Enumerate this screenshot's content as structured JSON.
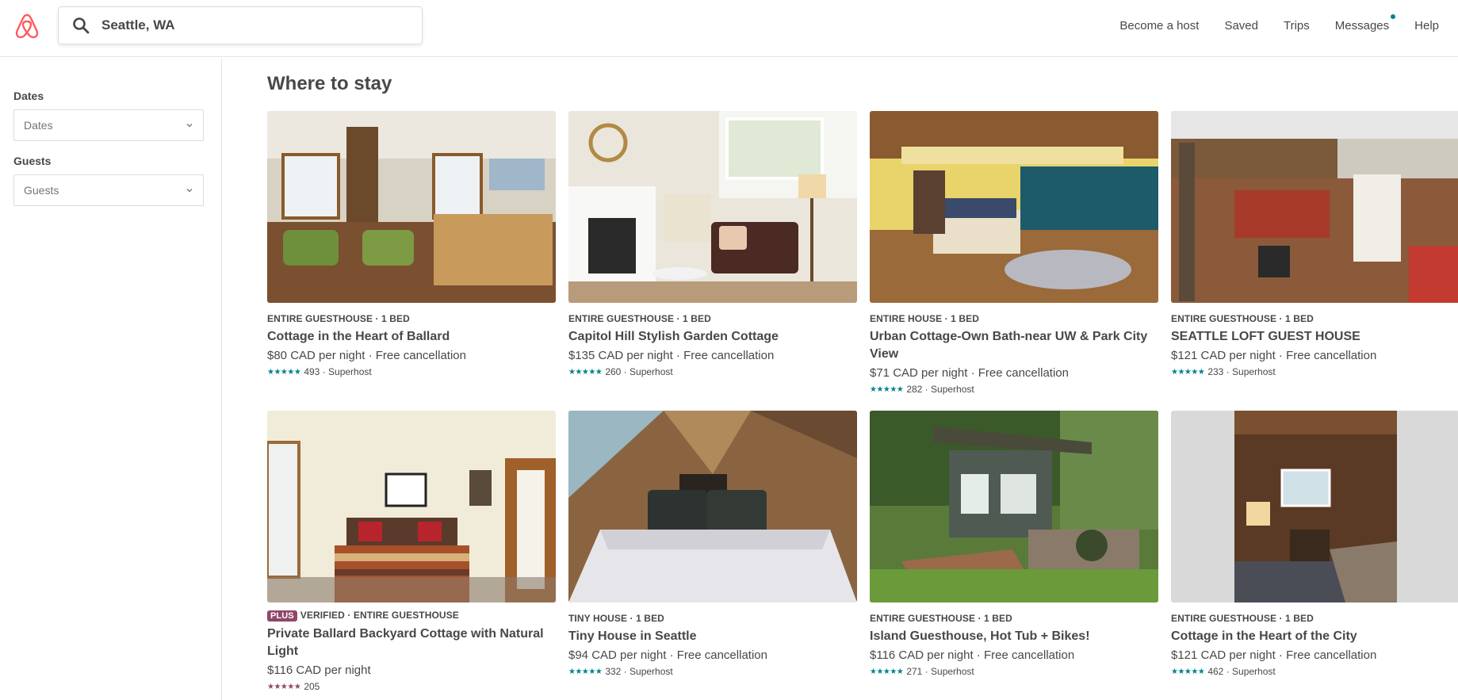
{
  "header": {
    "search_value": "Seattle, WA",
    "nav": [
      "Become a host",
      "Saved",
      "Trips",
      "Messages",
      "Help"
    ]
  },
  "sidebar": {
    "dates_label": "Dates",
    "dates_placeholder": "Dates",
    "guests_label": "Guests",
    "guests_placeholder": "Guests"
  },
  "main": {
    "title": "Where to stay",
    "listings": [
      {
        "badge": "",
        "kind": "ENTIRE GUESTHOUSE · 1 BED",
        "title": "Cottage in the Heart of Ballard",
        "price": "$80 CAD per night · Free cancellation",
        "stars": "★★★★★",
        "reviews": "493 · Superhost"
      },
      {
        "badge": "",
        "kind": "ENTIRE GUESTHOUSE · 1 BED",
        "title": "Capitol Hill Stylish Garden Cottage",
        "price": "$135 CAD per night · Free cancellation",
        "stars": "★★★★★",
        "reviews": "260 · Superhost"
      },
      {
        "badge": "",
        "kind": "ENTIRE HOUSE · 1 BED",
        "title": "Urban Cottage-Own Bath-near UW & Park City View",
        "price": "$71 CAD per night · Free cancellation",
        "stars": "★★★★★",
        "reviews": "282 · Superhost"
      },
      {
        "badge": "",
        "kind": "ENTIRE GUESTHOUSE · 1 BED",
        "title": "SEATTLE LOFT GUEST HOUSE",
        "price": "$121 CAD per night · Free cancellation",
        "stars": "★★★★★",
        "reviews": "233 · Superhost"
      },
      {
        "badge": "PLUS",
        "kind": "VERIFIED · ENTIRE GUESTHOUSE",
        "title": "Private Ballard Backyard Cottage with Natural Light",
        "price": "$116 CAD per night",
        "stars": "★★★★★",
        "reviews": "205"
      },
      {
        "badge": "",
        "kind": "TINY HOUSE · 1 BED",
        "title": "Tiny House in Seattle",
        "price": "$94 CAD per night · Free cancellation",
        "stars": "★★★★★",
        "reviews": "332 · Superhost"
      },
      {
        "badge": "",
        "kind": "ENTIRE GUESTHOUSE · 1 BED",
        "title": "Island Guesthouse, Hot Tub + Bikes!",
        "price": "$116 CAD per night · Free cancellation",
        "stars": "★★★★★",
        "reviews": "271 · Superhost"
      },
      {
        "badge": "",
        "kind": "ENTIRE GUESTHOUSE · 1 BED",
        "title": "Cottage in the Heart of the City",
        "price": "$121 CAD per night · Free cancellation",
        "stars": "★★★★★",
        "reviews": "462 · Superhost"
      }
    ]
  },
  "colors": {
    "brand": "#FF5A5F",
    "rating_teal": "#008489",
    "plus_purple": "#914669"
  }
}
